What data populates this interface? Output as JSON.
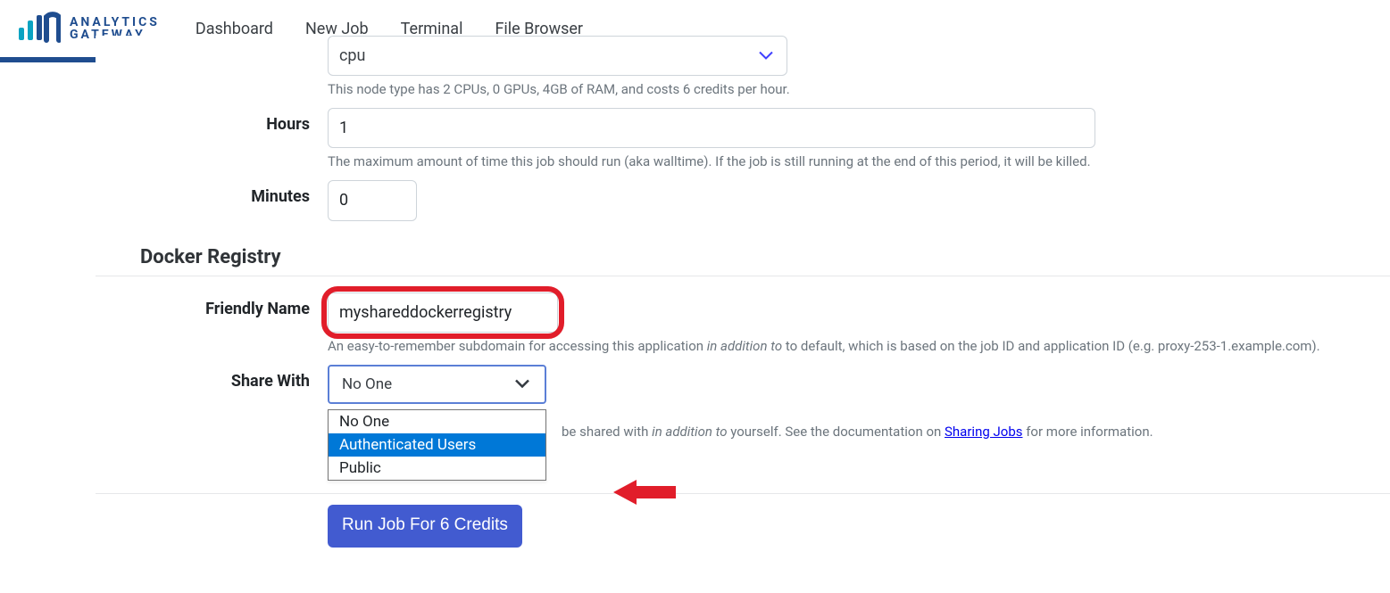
{
  "brand": {
    "line1": "ANALYTICS",
    "line2": "GATEWAY"
  },
  "nav": {
    "dashboard": "Dashboard",
    "new_job": "New Job",
    "terminal": "Terminal",
    "file_browser": "File Browser"
  },
  "form": {
    "cpu_label_partial": "cpu",
    "cpu_help": "This node type has 2 CPUs, 0 GPUs, 4GB of RAM, and costs 6 credits per hour.",
    "hours_label": "Hours",
    "hours_value": "1",
    "hours_help": "The maximum amount of time this job should run (aka walltime). If the job is still running at the end of this period, it will be killed.",
    "minutes_label": "Minutes",
    "minutes_value": "0",
    "section_docker": "Docker Registry",
    "friendly_label": "Friendly Name",
    "friendly_value": "myshareddockerregistry",
    "friendly_help_pre": "An easy-to-remember subdomain for accessing this application ",
    "friendly_help_em": "in addition to",
    "friendly_help_post": " to default, which is based on the job ID and application ID (e.g. proxy-253-1.example.com).",
    "share_label": "Share With",
    "share_selected": "No One",
    "share_options": {
      "o0": "No One",
      "o1": "Authenticated Users",
      "o2": "Public"
    },
    "share_help_pre_visible": "be shared with ",
    "share_help_em": "in addition to",
    "share_help_mid": " yourself. See the documentation on ",
    "share_help_link": "Sharing Jobs",
    "share_help_post": " for more information.",
    "run_button": "Run Job For 6 Credits"
  }
}
